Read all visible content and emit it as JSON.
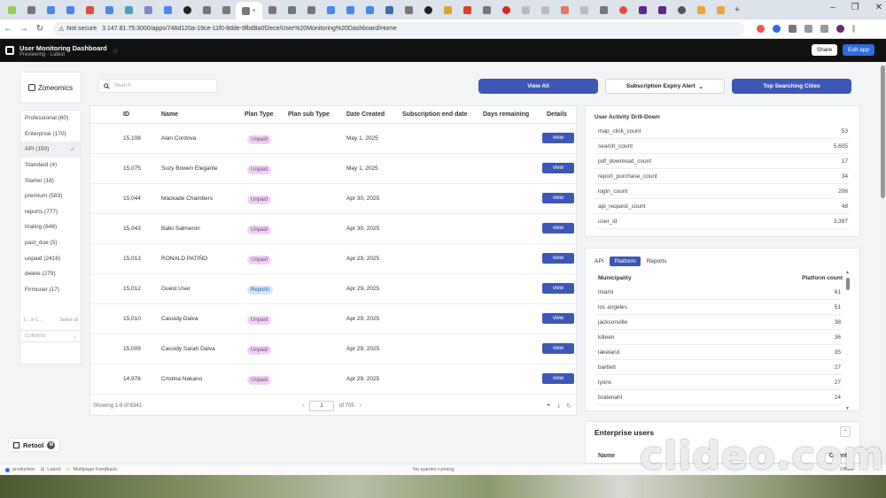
{
  "browser": {
    "url": "3.147.81.75:3000/apps/746d120a-19ce-11f0-8dde-9fbd8a0f2ece/User%20Monitoring%20Dashboard/Home",
    "security": "Not secure",
    "active_tab_close": "×",
    "new_tab": "+"
  },
  "header": {
    "title": "User Monitoring Dashboard",
    "subtitle": "Previewing · Latest",
    "share_label": "Share",
    "edit_label": "Edit app"
  },
  "logo": {
    "text": "Zoneomics"
  },
  "search": {
    "placeholder": "Search"
  },
  "toolbar": {
    "view_all": "View All",
    "expiry_alert": "Subscription Expiry Alert",
    "top_cities": "Top Searching Cities"
  },
  "filters": {
    "items": [
      "Professional (60)",
      "Enterprise (170)",
      "API (150)",
      "Standard (4)",
      "Starter (18)",
      "premium (583)",
      "reports (777)",
      "trialing (848)",
      "past_due (5)",
      "unpaid (2416)",
      "delete (279)",
      "Firmuser (17)"
    ],
    "footer_left": "1... ⊘ C...",
    "footer_right": "Select all",
    "columns_placeholder": "Columns"
  },
  "table": {
    "columns": [
      "ID",
      "Name",
      "Plan Type",
      "Plan sub Type",
      "Date Created",
      "Subscription end date",
      "Days remaining",
      "Details"
    ],
    "rows": [
      {
        "id": "15,108",
        "name": "Alan Cordova",
        "plan": "Unpaid",
        "date": "May 1, 2025",
        "action": "view"
      },
      {
        "id": "15,075",
        "name": "Suzy Bowen Elegante",
        "plan": "Unpaid",
        "date": "May 1, 2025",
        "action": "view"
      },
      {
        "id": "15,044",
        "name": "Mackade Chambers",
        "plan": "Unpaid",
        "date": "Apr 30, 2025",
        "action": "view"
      },
      {
        "id": "15,043",
        "name": "Balki Salmeron",
        "plan": "Unpaid",
        "date": "Apr 30, 2025",
        "action": "view"
      },
      {
        "id": "15,013",
        "name": "RONALD PATIÑO",
        "plan": "Unpaid",
        "date": "Apr 29, 2025",
        "action": "view"
      },
      {
        "id": "15,012",
        "name": "Guest User",
        "plan": "Reports",
        "date": "Apr 29, 2025",
        "action": "view"
      },
      {
        "id": "15,010",
        "name": "Cassidy Dalva",
        "plan": "Unpaid",
        "date": "Apr 29, 2025",
        "action": "view"
      },
      {
        "id": "15,009",
        "name": "Cassidy Sarah Dalva",
        "plan": "Unpaid",
        "date": "Apr 29, 2025",
        "action": "view"
      },
      {
        "id": "14,976",
        "name": "Cristina Nakano",
        "plan": "Unpaid",
        "date": "Apr 29, 2025",
        "action": "view"
      }
    ],
    "showing": "Showing 1-9 of 6341",
    "page": "1",
    "of_pages": "of 705"
  },
  "drilldown": {
    "title": "User Activity Drill-Down",
    "rows": [
      {
        "key": "map_click_count",
        "value": "53"
      },
      {
        "key": "search_count",
        "value": "5,605"
      },
      {
        "key": "pdf_download_count",
        "value": "17"
      },
      {
        "key": "report_purchase_count",
        "value": "34"
      },
      {
        "key": "login_count",
        "value": "206"
      },
      {
        "key": "api_request_count",
        "value": "48"
      },
      {
        "key": "user_id",
        "value": "3,397"
      }
    ]
  },
  "municipality": {
    "tabs": [
      "API",
      "Platform",
      "Reports"
    ],
    "active_tab": "Platform",
    "col_name": "Municipality",
    "col_count": "Platform count",
    "rows": [
      {
        "name": "miami",
        "count": "61"
      },
      {
        "name": "los angeles",
        "count": "51"
      },
      {
        "name": "jacksonville",
        "count": "38"
      },
      {
        "name": "killeen",
        "count": "36"
      },
      {
        "name": "lakeland",
        "count": "35"
      },
      {
        "name": "bartlett",
        "count": "27"
      },
      {
        "name": "lyons",
        "count": "27"
      },
      {
        "name": "bratenahl",
        "count": "24"
      }
    ]
  },
  "enterprise": {
    "title": "Enterprise users",
    "col_name": "Name",
    "col_count": "Count"
  },
  "retool_badge": {
    "label": "Retool",
    "avatar": "M"
  },
  "statusbar": {
    "env": "production",
    "version": "Latest",
    "page": "Multipage Feedback",
    "status": "No queries running",
    "right": "Offline"
  },
  "watermark": "clideo.com",
  "colors": {
    "primary": "#3d57b7",
    "unpaid_pill": "#ecd6ef",
    "reports_pill": "#d6e5f8",
    "header_bg": "#111111"
  }
}
